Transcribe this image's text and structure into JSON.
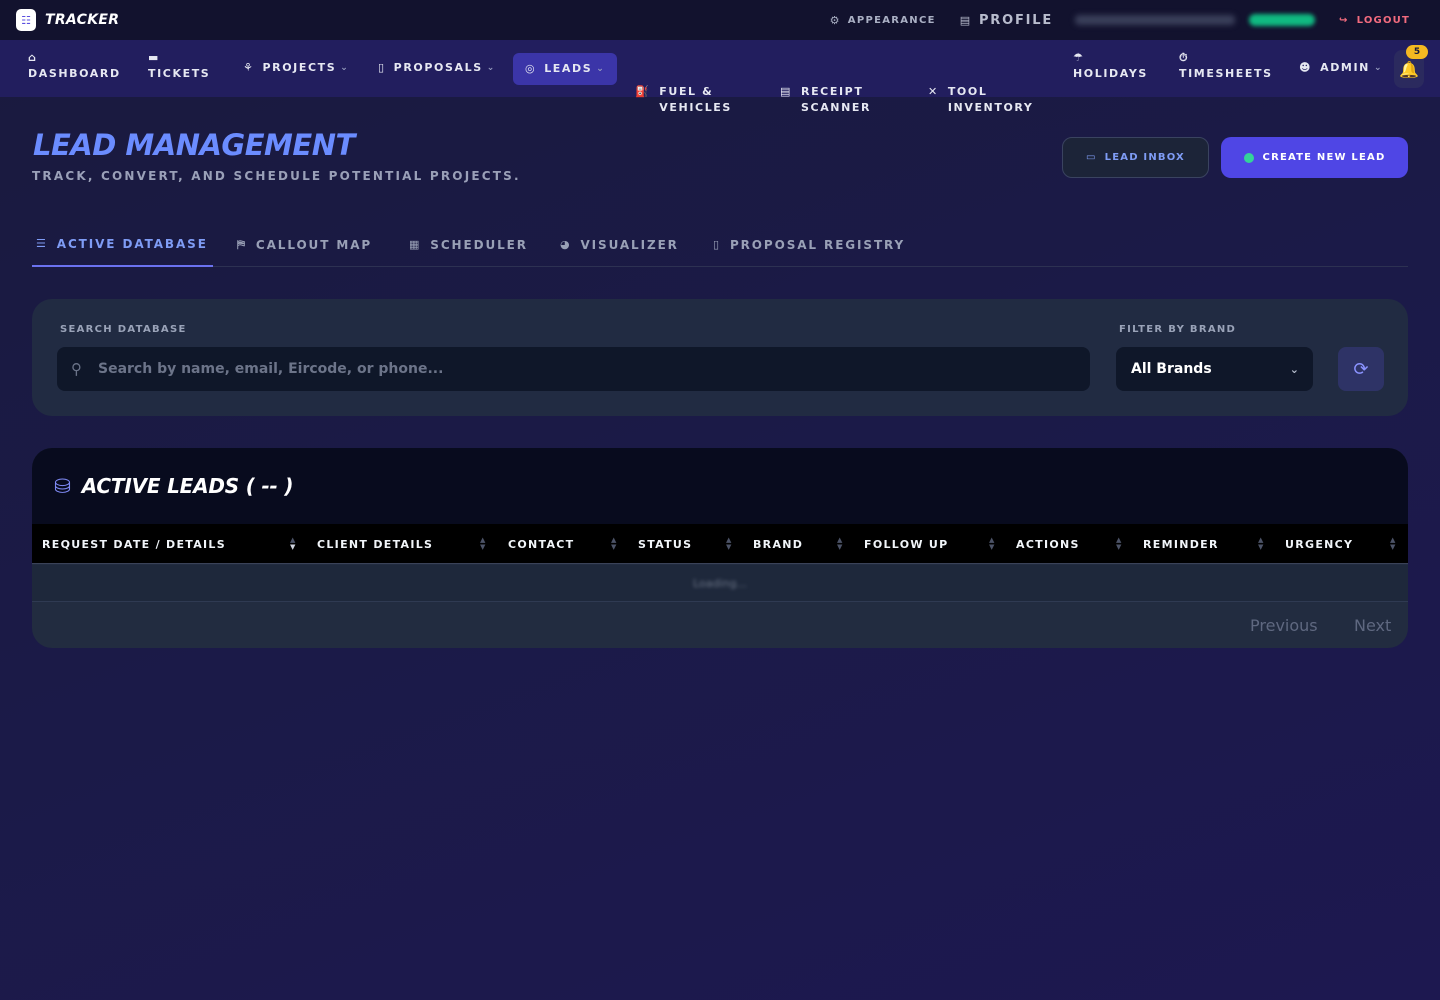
{
  "app": {
    "name": "TRACKER",
    "logo_glyph": "☷"
  },
  "topbar": {
    "appearance_label": "APPEARANCE",
    "profile_label": "PROFILE",
    "logout_label": "LOGOUT"
  },
  "nav": {
    "items": [
      {
        "label": "DASHBOARD",
        "icon": "home-icon"
      },
      {
        "label": "TICKETS",
        "icon": "ticket-icon"
      },
      {
        "label": "PROJECTS",
        "icon": "project-diagram-icon"
      },
      {
        "label": "PROPOSALS",
        "icon": "file-contract-icon"
      },
      {
        "label": "LEADS",
        "icon": "bullseye-icon",
        "active": true
      },
      {
        "label": "FUEL &\nVEHICLES",
        "icon": "gas-pump-icon"
      },
      {
        "label": "RECEIPT\nSCANNER",
        "icon": "receipt-icon"
      },
      {
        "label": "TOOL\nINVENTORY",
        "icon": "tools-icon"
      },
      {
        "label": "HOLIDAYS",
        "icon": "umbrella-beach-icon"
      },
      {
        "label": "TIMESHEETS",
        "icon": "stopwatch-icon"
      },
      {
        "label": "ADMIN",
        "icon": "user-cog-icon"
      }
    ],
    "notification_count": "5"
  },
  "header": {
    "title": "LEAD MANAGEMENT",
    "subtitle": "TRACK, CONVERT, AND SCHEDULE POTENTIAL PROJECTS.",
    "inbox_button": "LEAD INBOX",
    "create_button": "CREATE NEW LEAD"
  },
  "tabs": [
    {
      "label": "ACTIVE DATABASE",
      "icon": "list-icon",
      "active": true
    },
    {
      "label": "CALLOUT MAP",
      "icon": "map-marked-icon"
    },
    {
      "label": "SCHEDULER",
      "icon": "calendar-icon"
    },
    {
      "label": "VISUALIZER",
      "icon": "chart-pie-icon"
    },
    {
      "label": "PROPOSAL REGISTRY",
      "icon": "file-icon"
    }
  ],
  "filters": {
    "search_label": "SEARCH DATABASE",
    "search_placeholder": "Search by name, email, Eircode, or phone...",
    "search_value": "",
    "brand_label": "FILTER BY BRAND",
    "brand_value": "All Brands"
  },
  "table": {
    "title": "ACTIVE LEADS (  --  )",
    "columns": [
      "REQUEST DATE / DETAILS",
      "CLIENT DETAILS",
      "CONTACT",
      "STATUS",
      "BRAND",
      "FOLLOW UP",
      "ACTIONS",
      "REMINDER",
      "URGENCY"
    ],
    "loading_text": "Loading...",
    "previous_label": "Previous",
    "next_label": "Next"
  },
  "colors": {
    "accent": "#4f46e5",
    "title": "#6b8cff",
    "logout": "#f26b7e",
    "badge": "#f5b921",
    "online": "#10b981"
  }
}
